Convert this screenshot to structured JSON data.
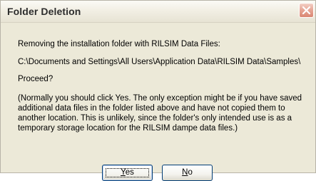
{
  "window": {
    "title": "Folder Deletion"
  },
  "message": {
    "line1": "Removing the installation folder with RILSIM Data Files:",
    "path": "C:\\Documents and Settings\\All Users\\Application Data\\RILSIM Data\\Samples\\",
    "question": "Proceed?",
    "note": "(Normally you should click Yes. The only exception might be if you have saved additional data files in the folder listed above and have not copied them to another location. This is unlikely, since the folder's only intended use is as a temporary storage location for the RILSIM dampe data files.)"
  },
  "buttons": {
    "yes_accel": "Y",
    "yes_rest": "es",
    "no_accel": "N",
    "no_rest": "o"
  },
  "icons": {
    "close": "close-icon"
  },
  "colors": {
    "dialog_bg": "#ece9d8",
    "close_button": "#e6a494",
    "button_border": "#003c74"
  }
}
